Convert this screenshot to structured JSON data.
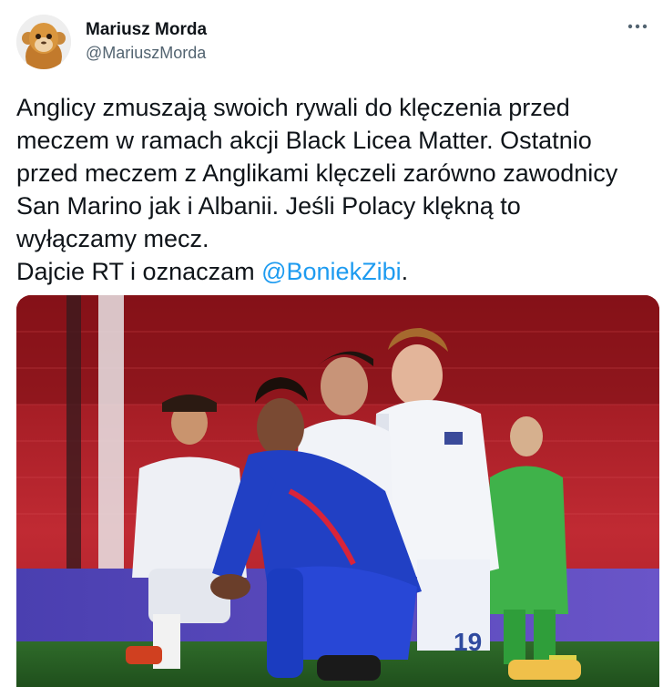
{
  "tweet": {
    "author_name": "Mariusz Morda",
    "author_handle": "@MariuszMorda",
    "more_icon": "more-horizontal-icon",
    "text_lines": [
      "Anglicy zmuszają swoich rywali do klęczenia przed",
      "meczem w ramach akcji Black Licea Matter. Ostatnio",
      "przed meczem z Anglikami  klęczeli zarówno zawodnicy",
      "San Marino jak i Albanii. Jeśli Polacy klękną to",
      "wyłączamy mecz.",
      "Dajcie RT i oznaczam "
    ],
    "mention": "@BoniekZibi",
    "trailing": "."
  },
  "media": {
    "shirt_number": "19"
  },
  "colors": {
    "mention": "#1d9bf0",
    "handle": "#536471",
    "stadium_red": "#b3202a",
    "england_blue": "#1f3fb8"
  }
}
